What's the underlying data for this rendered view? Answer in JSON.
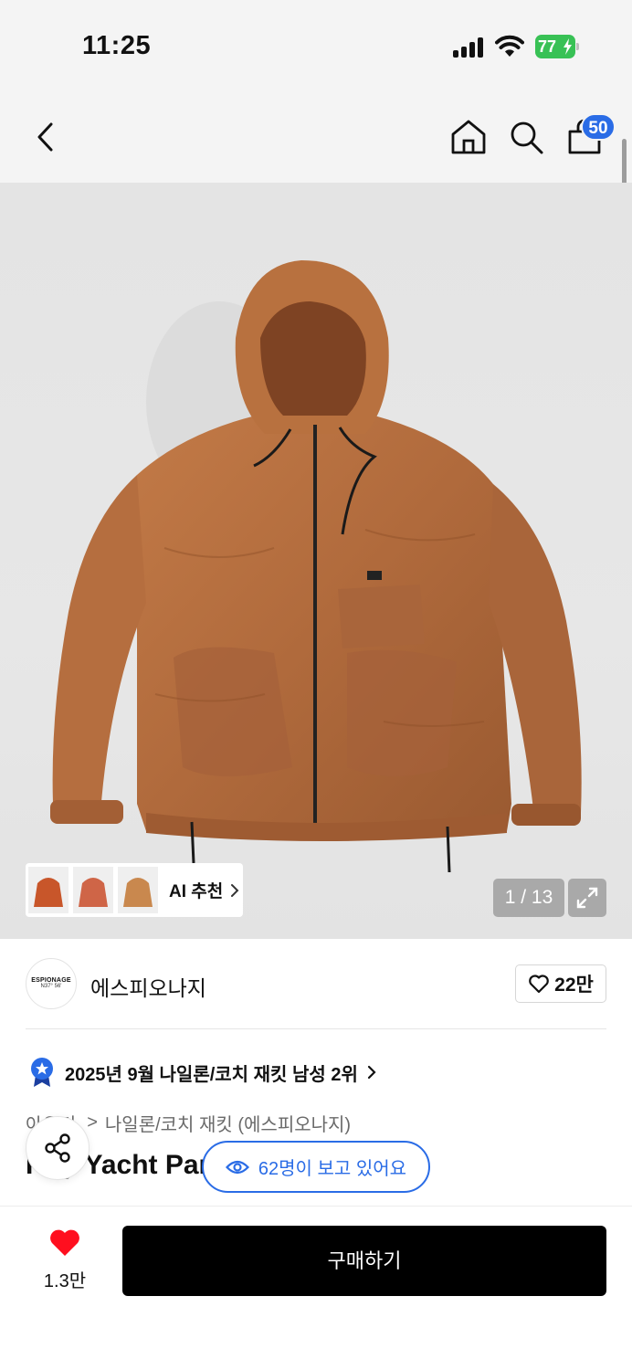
{
  "status_bar": {
    "time": "11:25",
    "battery": "77"
  },
  "header": {
    "cart_count": "50"
  },
  "gallery": {
    "ai_label": "AI 추천",
    "page_counter": "1 / 13"
  },
  "brand": {
    "logo_line1": "ESPIONAGE",
    "logo_line2": "N37° 56'",
    "name": "에스피오나지",
    "likes": "22만"
  },
  "ranking": {
    "text": "2025년 9월 나일론/코치 재킷 남성 2위"
  },
  "breadcrumb": {
    "parent": "아우터",
    "separator": ">",
    "current": "나일론/코치 재킷 (에스피오나지)"
  },
  "product": {
    "title": "Roy Yacht Parka"
  },
  "viewers": {
    "text": "62명이 보고 있어요"
  },
  "bottom": {
    "like_count": "1.3만",
    "buy_label": "구매하기"
  },
  "colors": {
    "accent_blue": "#2a6ce6",
    "heart_red": "#ff0f1f",
    "jacket": "#b06a3c",
    "battery_green": "#38c155"
  }
}
